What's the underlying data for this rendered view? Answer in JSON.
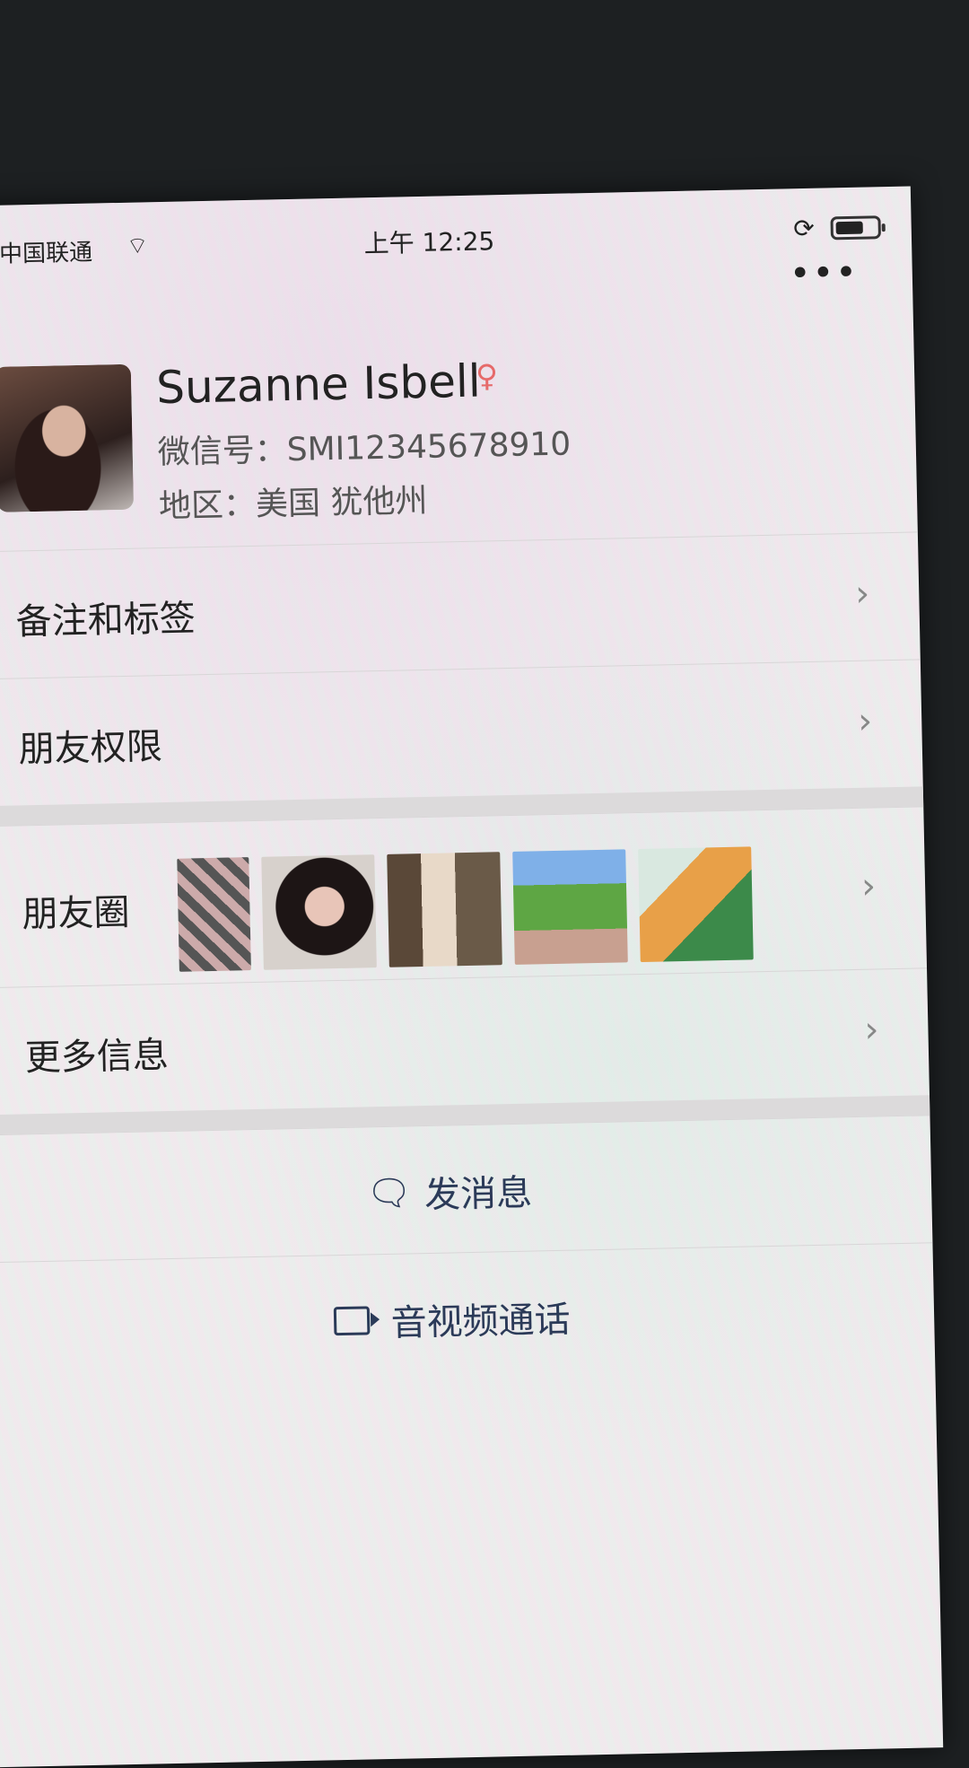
{
  "status_bar": {
    "carrier": "中国联通",
    "time": "上午 12:25",
    "wifi_icon": "wifi-icon",
    "rotation_lock_icon": "rotation-lock-icon",
    "battery_level": 0.6
  },
  "header": {
    "more_label": "•••"
  },
  "profile": {
    "name": "Suzanne Isbell",
    "gender_icon": "female-icon",
    "wechat_id": "微信号：SMI12345678910",
    "region": "地区：美国 犹他州"
  },
  "rows": {
    "remarks": "备注和标签",
    "permissions": "朋友权限",
    "moments": "朋友圈",
    "more_info": "更多信息"
  },
  "moments_thumbs": [
    "photo-collage",
    "portrait-photo",
    "tree-photo",
    "meadow-photo",
    "drinks-photo"
  ],
  "actions": {
    "message": "发消息",
    "video_call": "音视频通话"
  }
}
